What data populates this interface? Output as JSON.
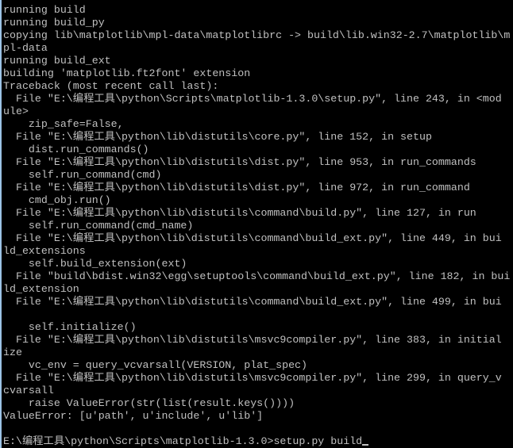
{
  "console": {
    "output_lines": [
      "running build",
      "running build_py",
      "copying lib\\matplotlib\\mpl-data\\matplotlibrc -> build\\lib.win32-2.7\\matplotlib\\m",
      "pl-data",
      "running build_ext",
      "building 'matplotlib.ft2font' extension",
      "Traceback (most recent call last):",
      "  File \"E:\\编程工具\\python\\Scripts\\matplotlib-1.3.0\\setup.py\", line 243, in <mod",
      "ule>",
      "    zip_safe=False,",
      "  File \"E:\\编程工具\\python\\lib\\distutils\\core.py\", line 152, in setup",
      "    dist.run_commands()",
      "  File \"E:\\编程工具\\python\\lib\\distutils\\dist.py\", line 953, in run_commands",
      "    self.run_command(cmd)",
      "  File \"E:\\编程工具\\python\\lib\\distutils\\dist.py\", line 972, in run_command",
      "    cmd_obj.run()",
      "  File \"E:\\编程工具\\python\\lib\\distutils\\command\\build.py\", line 127, in run",
      "    self.run_command(cmd_name)",
      "  File \"E:\\编程工具\\python\\lib\\distutils\\command\\build_ext.py\", line 449, in bui",
      "ld_extensions",
      "    self.build_extension(ext)",
      "  File \"build\\bdist.win32\\egg\\setuptools\\command\\build_ext.py\", line 182, in bui",
      "ld_extension",
      "  File \"E:\\编程工具\\python\\lib\\distutils\\command\\build_ext.py\", line 499, in bui",
      "",
      "    self.initialize()",
      "  File \"E:\\编程工具\\python\\lib\\distutils\\msvc9compiler.py\", line 383, in initial",
      "ize",
      "    vc_env = query_vcvarsall(VERSION, plat_spec)",
      "  File \"E:\\编程工具\\python\\lib\\distutils\\msvc9compiler.py\", line 299, in query_v",
      "cvarsall",
      "    raise ValueError(str(list(result.keys())))",
      "ValueError: [u'path', u'include', u'lib']",
      ""
    ],
    "prompt": "E:\\编程工具\\python\\Scripts\\matplotlib-1.3.0>",
    "command": "setup.py build"
  },
  "colors": {
    "background": "#000000",
    "text": "#c0c0c0"
  }
}
